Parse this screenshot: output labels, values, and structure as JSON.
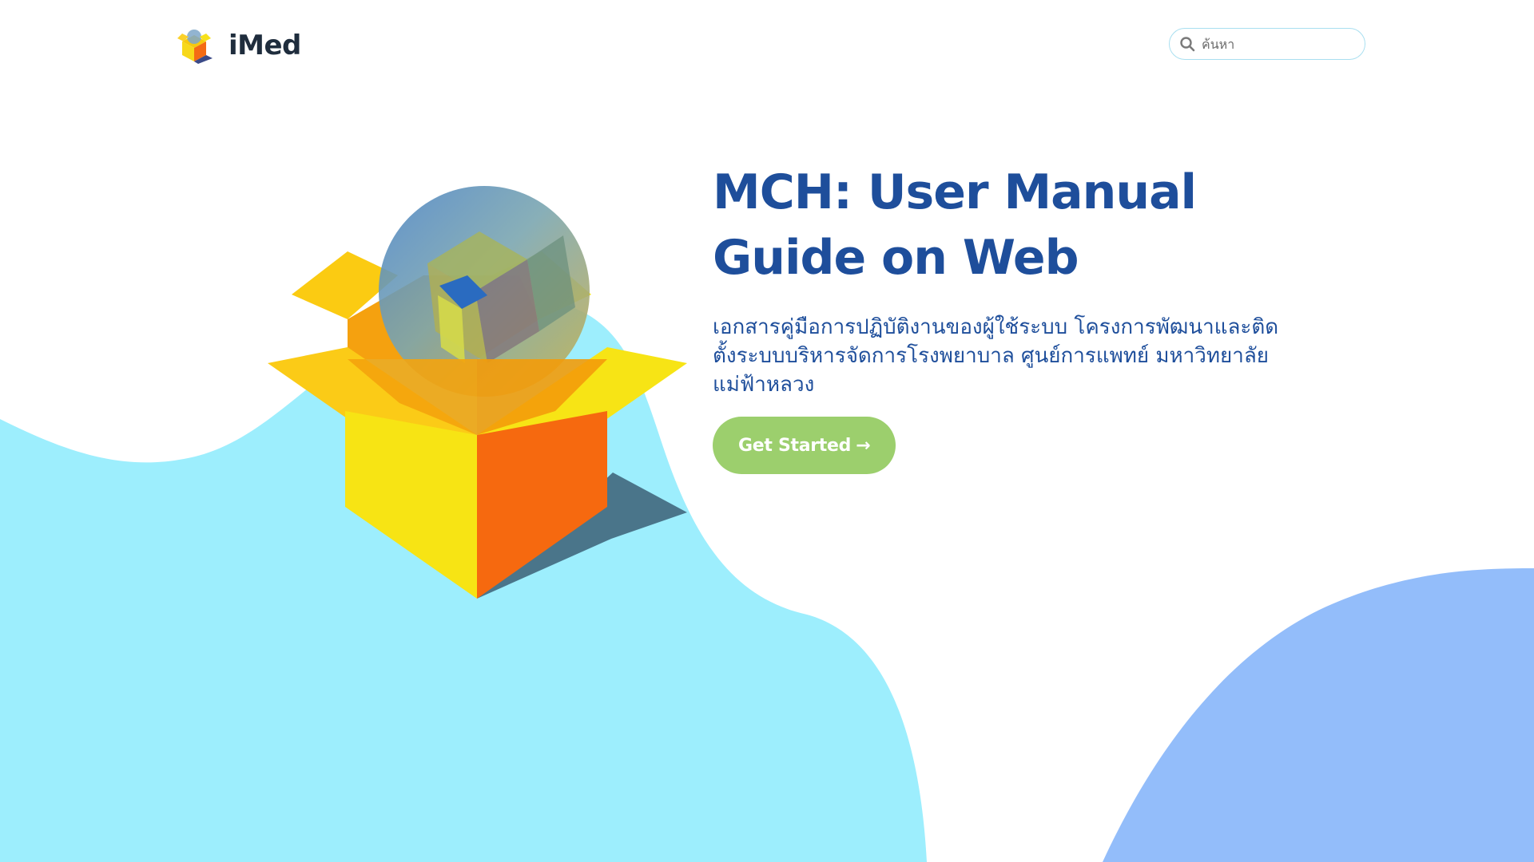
{
  "brand": {
    "name": "iMed",
    "logo_icon": "imed-box-logo-icon"
  },
  "search": {
    "placeholder": "ค้นหา",
    "value": "",
    "icon": "search-icon"
  },
  "hero": {
    "title_line1": "MCH: User Manual",
    "title_line2": "Guide on Web",
    "description": "เอกสารคู่มือการปฏิบัติงานของผู้ใช้ระบบ โครงการพัฒนาและติดตั้งระบบบริหารจัดการโรงพยาบาล ศูนย์การแพทย์ มหาวิทยาลัยแม่ฟ้าหลวง",
    "cta_label": "Get Started",
    "cta_arrow": "→",
    "illustration_icon": "open-box-with-globe-icon"
  },
  "colors": {
    "title": "#1e4e9b",
    "cta_background": "#9ccf6d",
    "left_blob": "#9deefd",
    "right_blob": "#93bdfa",
    "search_border": "#a9dff0"
  }
}
